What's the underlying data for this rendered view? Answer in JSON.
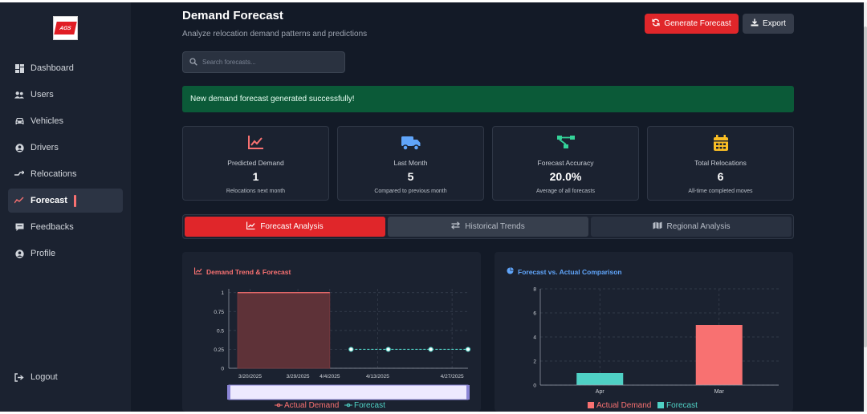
{
  "brand": {
    "logo_text": "AGS"
  },
  "sidebar": {
    "items": [
      {
        "label": "Dashboard",
        "icon": "dashboard-icon"
      },
      {
        "label": "Users",
        "icon": "users-icon"
      },
      {
        "label": "Vehicles",
        "icon": "car-icon"
      },
      {
        "label": "Drivers",
        "icon": "user-circle-icon"
      },
      {
        "label": "Relocations",
        "icon": "route-icon"
      },
      {
        "label": "Forecast",
        "icon": "chart-line-icon",
        "active": true
      },
      {
        "label": "Feedbacks",
        "icon": "comment-icon"
      },
      {
        "label": "Profile",
        "icon": "user-circle-icon"
      }
    ],
    "logout_label": "Logout"
  },
  "header": {
    "title": "Demand Forecast",
    "subtitle": "Analyze relocation demand patterns and predictions",
    "generate_label": "Generate Forecast",
    "export_label": "Export"
  },
  "search": {
    "placeholder": "Search forecasts...",
    "value": ""
  },
  "alert": {
    "message": "New demand forecast generated successfully!"
  },
  "stats": [
    {
      "label": "Predicted Demand",
      "value": "1",
      "desc": "Relocations next month",
      "icon": "chart-line-icon",
      "color": "#f87171"
    },
    {
      "label": "Last Month",
      "value": "5",
      "desc": "Compared to previous month",
      "icon": "truck-icon",
      "color": "#60a5fa"
    },
    {
      "label": "Forecast Accuracy",
      "value": "20.0%",
      "desc": "Average of all forecasts",
      "icon": "network-icon",
      "color": "#34d399"
    },
    {
      "label": "Total Relocations",
      "value": "6",
      "desc": "All-time completed moves",
      "icon": "calendar-icon",
      "color": "#fbbf24"
    }
  ],
  "tabs": [
    {
      "label": "Forecast Analysis",
      "active": true
    },
    {
      "label": "Historical Trends",
      "active": false
    },
    {
      "label": "Regional Analysis",
      "active": false
    }
  ],
  "colors": {
    "accent": "#e0262a",
    "actual": "#f87171",
    "forecast": "#4fd1c5",
    "success": "#0b5a38"
  },
  "chart_data": [
    {
      "type": "area",
      "title": "Demand Trend & Forecast",
      "x_ticks": [
        "3/20/2025",
        "3/29/2025",
        "4/4/2025",
        "4/13/2025",
        "4/27/2025"
      ],
      "y_ticks": [
        "0",
        "0.25",
        "0.5",
        "0.75",
        "1"
      ],
      "ylim": [
        0,
        1.05
      ],
      "series": [
        {
          "name": "Actual Demand",
          "style": "step-area",
          "points": [
            [
              "3/16/2025",
              1
            ],
            [
              "4/4/2025",
              1
            ]
          ]
        },
        {
          "name": "Forecast",
          "style": "dashed-line",
          "points": [
            [
              "4/8/2025",
              0.25
            ],
            [
              "4/15/2025",
              0.25
            ],
            [
              "4/23/2025",
              0.25
            ],
            [
              "4/30/2025",
              0.25
            ]
          ]
        }
      ],
      "legend": "bottom",
      "grid": true,
      "brush": true
    },
    {
      "type": "bar",
      "title": "Forecast vs. Actual Comparison",
      "categories": [
        "Apr",
        "Mar"
      ],
      "y_ticks": [
        "0",
        "2",
        "4",
        "6",
        "8"
      ],
      "ylim": [
        0,
        8
      ],
      "series": [
        {
          "name": "Actual Demand",
          "values": [
            0,
            5
          ]
        },
        {
          "name": "Forecast",
          "values": [
            1,
            0
          ]
        }
      ],
      "legend": "bottom",
      "grid": true
    }
  ]
}
